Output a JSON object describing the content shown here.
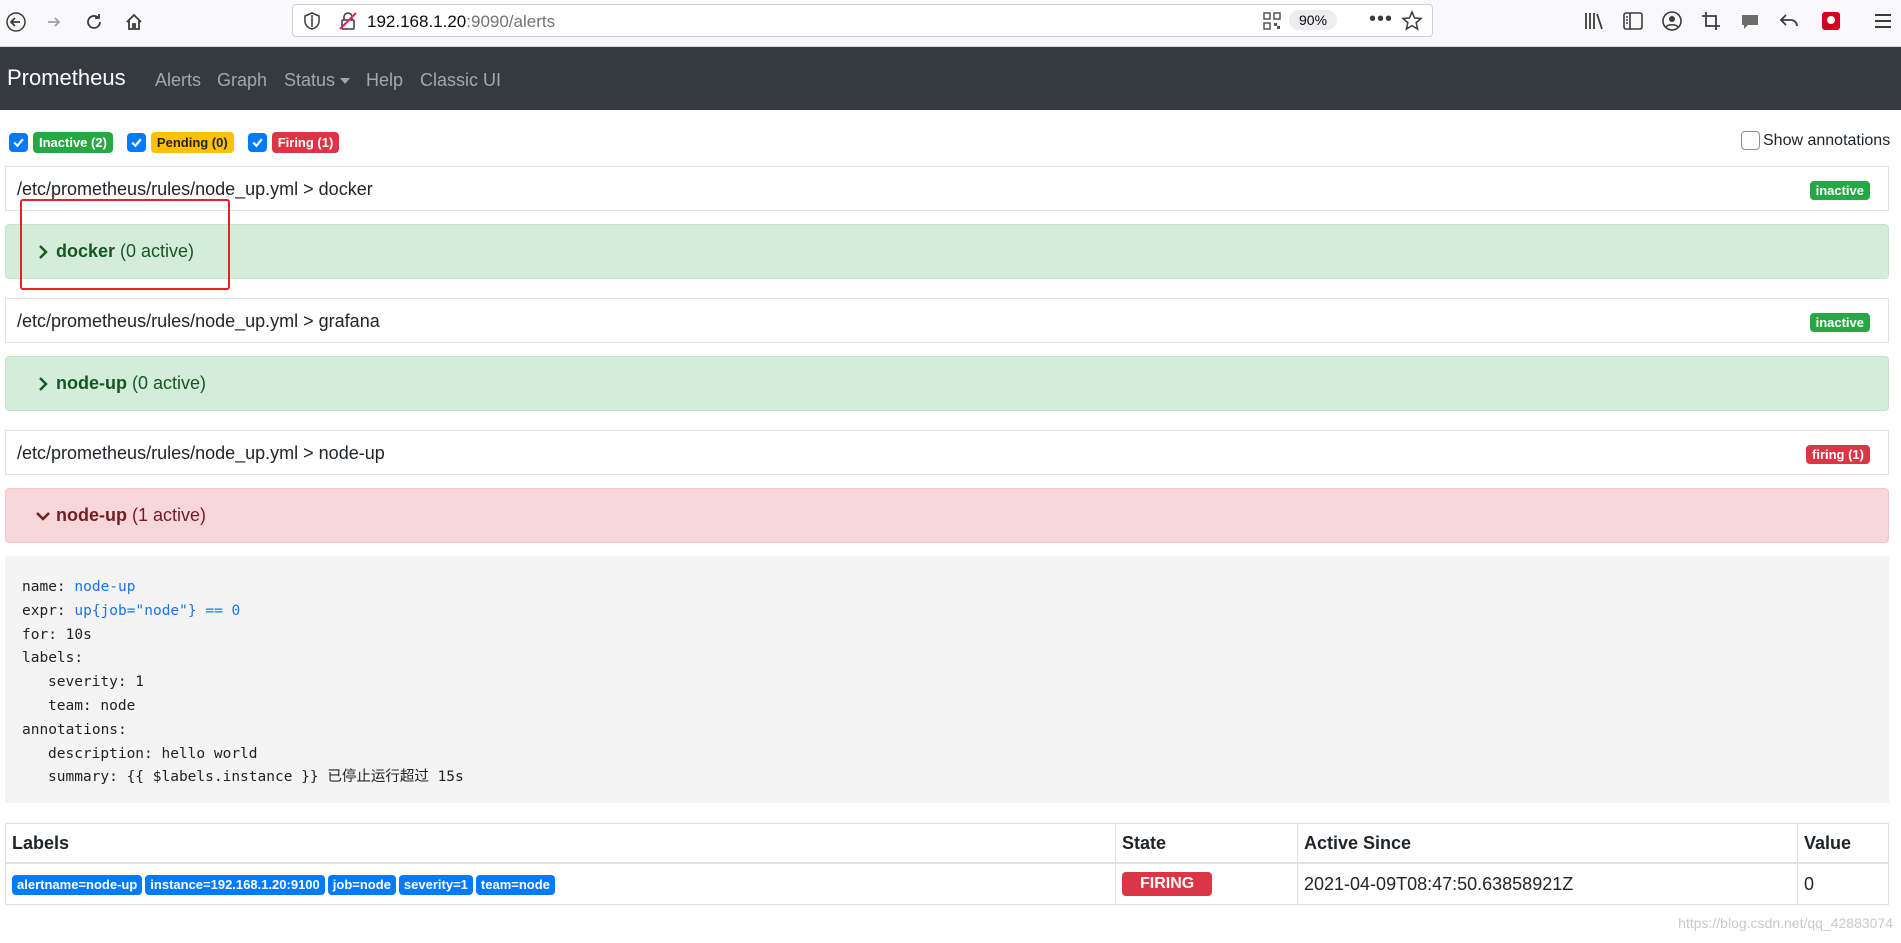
{
  "browser": {
    "url_host": "192.168.1.20",
    "url_rest": ":9090/alerts",
    "zoom": "90%"
  },
  "navbar": {
    "brand": "Prometheus",
    "links": [
      "Alerts",
      "Graph",
      "Status",
      "Help",
      "Classic UI"
    ]
  },
  "filters": {
    "inactive": "Inactive (2)",
    "pending": "Pending (0)",
    "firing": "Firing (1)",
    "show_annotations": "Show annotations"
  },
  "groups": [
    {
      "path": "/etc/prometheus/rules/node_up.yml > docker",
      "state": "inactive",
      "rule_name": "docker",
      "rule_count": "(0 active)"
    },
    {
      "path": "/etc/prometheus/rules/node_up.yml > grafana",
      "state": "inactive",
      "rule_name": "node-up",
      "rule_count": "(0 active)"
    },
    {
      "path": "/etc/prometheus/rules/node_up.yml > node-up",
      "state": "firing (1)",
      "rule_name": "node-up",
      "rule_count": "(1 active)"
    }
  ],
  "rule_definition": {
    "name_key": "name:",
    "name_val": "node-up",
    "expr_key": "expr:",
    "expr_val": "up{job=\"node\"} == 0",
    "for_line": "for: 10s",
    "labels_key": "labels:",
    "severity_line": "severity: 1",
    "team_line": "team: node",
    "annotations_key": "annotations:",
    "description_line": "description: hello world",
    "summary_line": "summary: {{ $labels.instance }} 已停止运行超过 15s"
  },
  "alerts_table": {
    "headers": [
      "Labels",
      "State",
      "Active Since",
      "Value"
    ],
    "rows": [
      {
        "labels": [
          "alertname=node-up",
          "instance=192.168.1.20:9100",
          "job=node",
          "severity=1",
          "team=node"
        ],
        "state": "FIRING",
        "active_since": "2021-04-09T08:47:50.63858921Z",
        "value": "0"
      }
    ]
  },
  "watermark": "https://blog.csdn.net/qq_42883074",
  "colors": {
    "navbar": "#343a40",
    "inactive": "#28a745",
    "pending": "#ffc107",
    "firing": "#dc3545",
    "label_badge": "#007bff"
  }
}
